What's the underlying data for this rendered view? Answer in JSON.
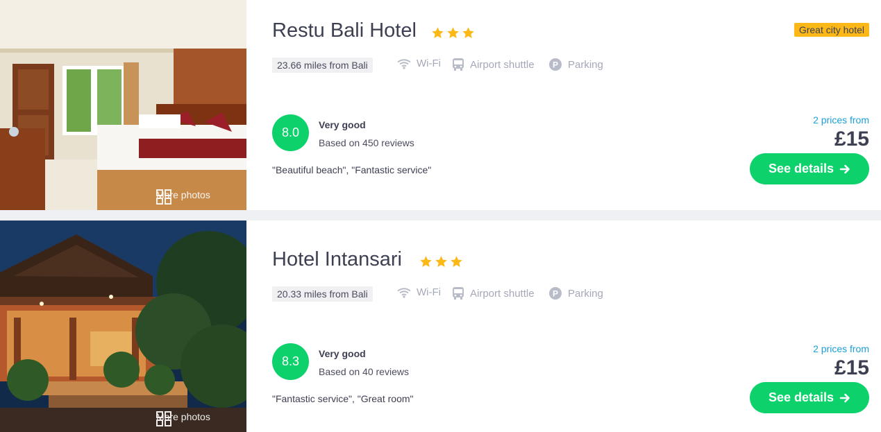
{
  "hotels": [
    {
      "name": "Restu Bali Hotel",
      "star_count": 3,
      "badge": "Great city hotel",
      "distance": "23.66 miles from Bali",
      "amenities": {
        "wifi": "Wi-Fi",
        "shuttle": "Airport shuttle",
        "parking": "Parking"
      },
      "score": "8.0",
      "rating_label": "Very good",
      "reviews": "Based on 450 reviews",
      "quote": "\"Beautiful beach\", \"Fantastic service\"",
      "prices_from": "2 prices from",
      "price": "£15",
      "button_label": "See details",
      "more_photos": "More photos"
    },
    {
      "name": "Hotel Intansari",
      "star_count": 3,
      "distance": "20.33 miles from Bali",
      "amenities": {
        "wifi": "Wi-Fi",
        "shuttle": "Airport shuttle",
        "parking": "Parking"
      },
      "score": "8.3",
      "rating_label": "Very good",
      "reviews": "Based on 40 reviews",
      "quote": "\"Fantastic service\", \"Great room\"",
      "prices_from": "2 prices from",
      "price": "£15",
      "button_label": "See details",
      "more_photos": "More photos"
    }
  ],
  "colors": {
    "score_green": "#0dd26c",
    "star_yellow": "#fcb816",
    "badge_yellow": "#fcb816",
    "link_blue": "#1ba0d8",
    "text_dark": "#3d3f52",
    "amenity_grey": "#a5a8b8"
  }
}
